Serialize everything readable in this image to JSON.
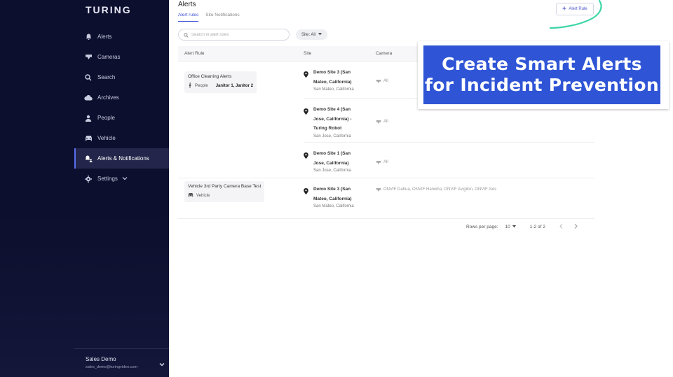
{
  "sidebar": {
    "logo": "TURING",
    "items": [
      {
        "label": "Alerts",
        "icon": "bell-icon"
      },
      {
        "label": "Cameras",
        "icon": "camera-icon"
      },
      {
        "label": "Search",
        "icon": "search-icon"
      },
      {
        "label": "Archives",
        "icon": "cloud-icon"
      },
      {
        "label": "People",
        "icon": "person-icon"
      },
      {
        "label": "Vehicle",
        "icon": "car-icon"
      },
      {
        "label": "Alerts & Notifications",
        "icon": "bell-person-icon",
        "active": true
      },
      {
        "label": "Settings",
        "icon": "gear-icon"
      }
    ],
    "user": {
      "name": "Sales Demo",
      "email": "sales_demo@turingvideo.com"
    }
  },
  "header": {
    "title": "Alerts",
    "tabs": [
      "Alert rules",
      "Site Notifications"
    ],
    "add_button": "Alert Rule"
  },
  "filters": {
    "search_placeholder": "Search in alert rules",
    "site_filter": "Site: All"
  },
  "table": {
    "columns": [
      "Alert Rule",
      "Site",
      "Camera"
    ],
    "groups": [
      {
        "rule": "Office Cleaning Alerts",
        "type": "People",
        "detail": "Janitor 1, Janitor 2",
        "sites": [
          {
            "name": "Demo Site 3 (San Mateo, California)",
            "location": "San Mateo, California",
            "camera": "All"
          },
          {
            "name": "Demo Site 4 (San Jose, California) - Turing Robot",
            "location": "San Jose, California",
            "camera": "All"
          },
          {
            "name": "Demo Site 1 (San Jose, California)",
            "location": "San Jose, California",
            "camera": "All"
          }
        ]
      },
      {
        "rule": "Vehicle 3rd Party Camera Base Test",
        "type": "Vehicle",
        "detail": "",
        "sites": [
          {
            "name": "Demo Site 3 (San Mateo, California)",
            "location": "San Mateo, California",
            "camera": "ONVIF Dahua, ONVIF Hanwha, ONVIF Avigilon, ONVIF Axis"
          }
        ]
      }
    ]
  },
  "pagination": {
    "rows_per_page_label": "Rows per page:",
    "rows_per_page": "10",
    "range": "1-2 of 2"
  },
  "promo": {
    "line1": "Create Smart Alerts",
    "line2": "for Incident Prevention"
  },
  "colors": {
    "sidebar_bg": "#0d0f2e",
    "accent": "#3e4fd6",
    "promo_bg": "#2f55d6",
    "annotation": "#3fd6a8"
  }
}
